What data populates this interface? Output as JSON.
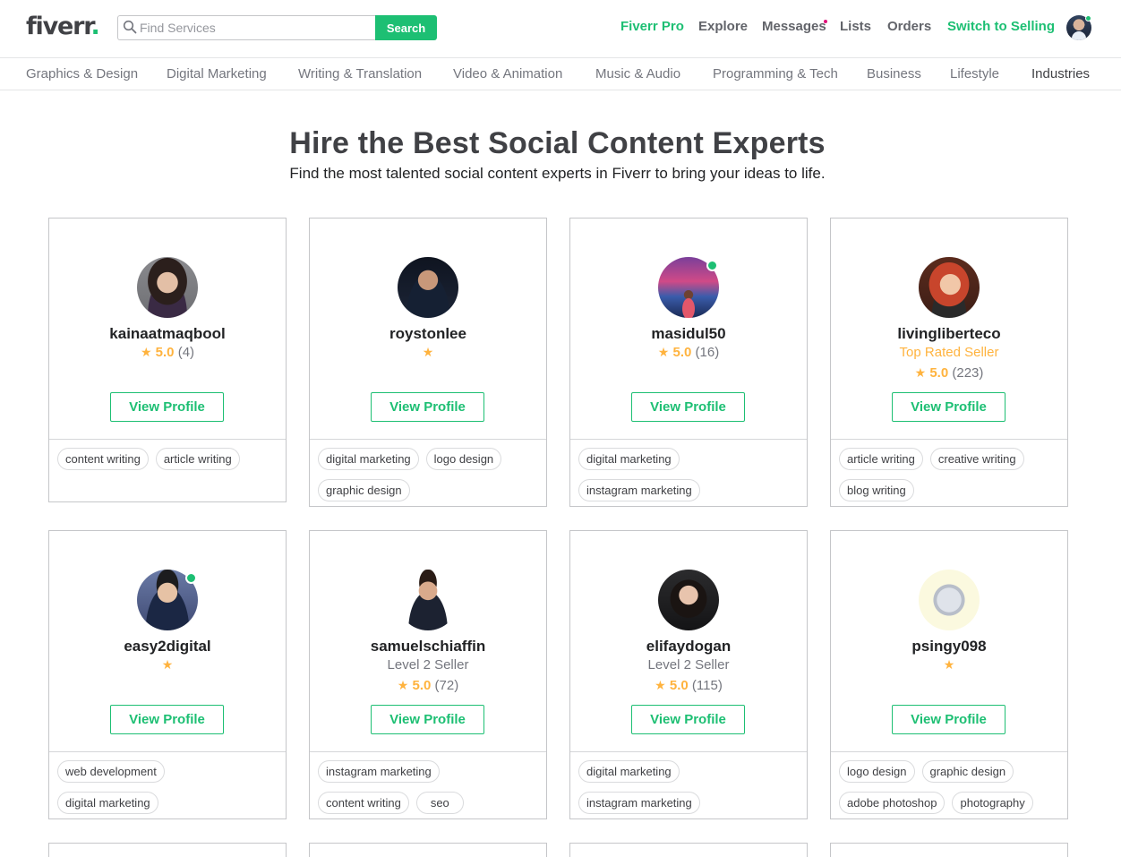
{
  "header": {
    "logo_text": "fiverr",
    "logo_dot": ".",
    "search_placeholder": "Find Services",
    "search_button": "Search",
    "nav": {
      "pro": "Fiverr Pro",
      "explore": "Explore",
      "messages": "Messages",
      "lists": "Lists",
      "orders": "Orders",
      "switch": "Switch to Selling"
    }
  },
  "categories": [
    "Graphics & Design",
    "Digital Marketing",
    "Writing & Translation",
    "Video & Animation",
    "Music & Audio",
    "Programming & Tech",
    "Business",
    "Lifestyle",
    "Industries"
  ],
  "hero": {
    "title": "Hire the Best Social Content Experts",
    "subtitle": "Find the most talented social content experts in Fiverr to bring your ideas to life."
  },
  "view_profile_label": "View Profile",
  "sellers": [
    {
      "username": "kainaatmaqbool",
      "level": "",
      "star": "★",
      "score": "5.0",
      "count": "(4)",
      "online": false,
      "tags": [
        "content writing",
        "article writing"
      ]
    },
    {
      "username": "roystonlee",
      "level": "",
      "star": "★",
      "score": "",
      "count": "",
      "online": false,
      "tags": [
        "digital marketing",
        "logo design",
        "graphic design"
      ]
    },
    {
      "username": "masidul50",
      "level": "",
      "star": "★",
      "score": "5.0",
      "count": "(16)",
      "online": true,
      "tags": [
        "digital marketing",
        "instagram marketing"
      ]
    },
    {
      "username": "livingliberteco",
      "level": "Top Rated Seller",
      "star": "★",
      "score": "5.0",
      "count": "(223)",
      "online": false,
      "tags": [
        "article writing",
        "creative writing",
        "blog writing"
      ]
    },
    {
      "username": "easy2digital",
      "level": "",
      "star": "★",
      "score": "",
      "count": "",
      "online": true,
      "tags": [
        "web development",
        "digital marketing"
      ]
    },
    {
      "username": "samuelschiaffin",
      "level": "Level 2 Seller",
      "star": "★",
      "score": "5.0",
      "count": "(72)",
      "online": false,
      "tags": [
        "instagram marketing",
        "content writing",
        "seo"
      ]
    },
    {
      "username": "elifaydogan",
      "level": "Level 2 Seller",
      "star": "★",
      "score": "5.0",
      "count": "(115)",
      "online": false,
      "tags": [
        "digital marketing",
        "instagram marketing"
      ]
    },
    {
      "username": "psingy098",
      "level": "",
      "star": "★",
      "score": "",
      "count": "",
      "online": false,
      "tags": [
        "logo design",
        "graphic design",
        "adobe photoshop",
        "photography"
      ]
    }
  ]
}
